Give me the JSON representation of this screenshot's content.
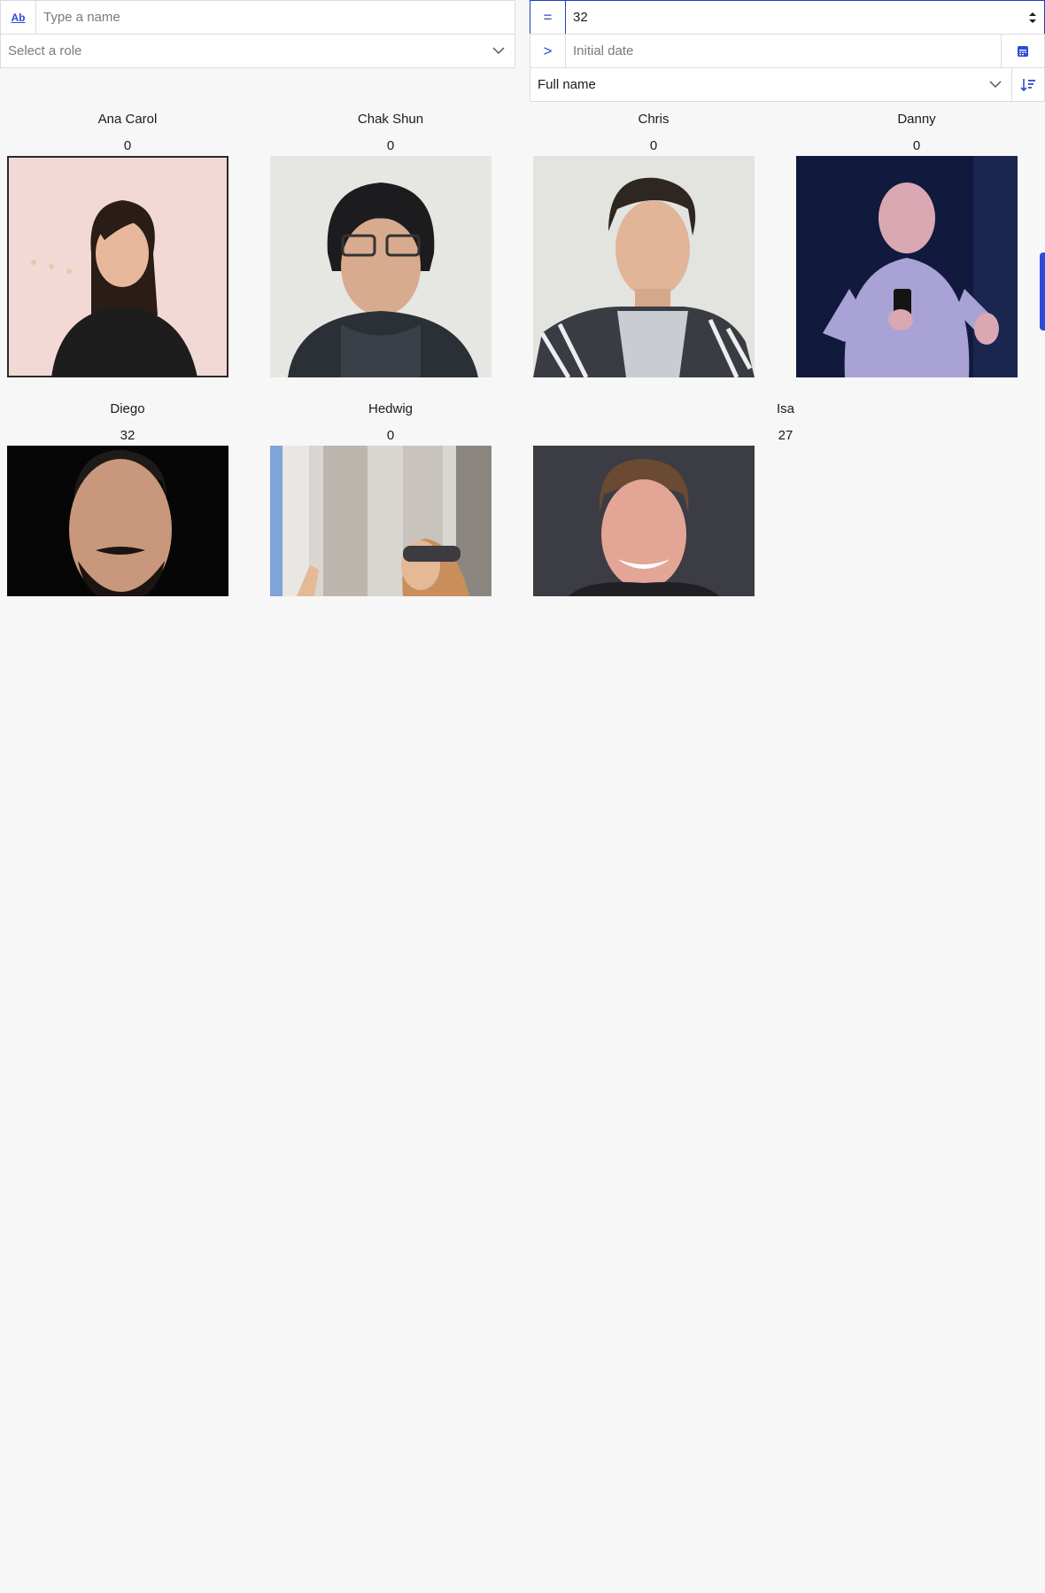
{
  "filters": {
    "name_placeholder": "Type a name",
    "name_addon": "Ab",
    "role_placeholder": "Select a role",
    "number_operator": "=",
    "number_value": "32",
    "date_operator": ">",
    "date_placeholder": "Initial date",
    "sort_field": "Full name"
  },
  "people": [
    {
      "name": "Ana Carol",
      "value": "0"
    },
    {
      "name": "Chak Shun",
      "value": "0"
    },
    {
      "name": "Chris",
      "value": "0"
    },
    {
      "name": "Danny",
      "value": "0"
    },
    {
      "name": "Diego",
      "value": "32"
    },
    {
      "name": "Hedwig",
      "value": "0"
    },
    {
      "name": "Isa",
      "value": "27"
    }
  ],
  "icons": {
    "date_picker": "calendar-icon",
    "sort": "sort-descending-icon",
    "dropdown": "chevron-down-icon",
    "stepper": "stepper-arrows-icon"
  },
  "colors": {
    "accent": "#2c4bd6",
    "background": "#f7f7f7"
  }
}
